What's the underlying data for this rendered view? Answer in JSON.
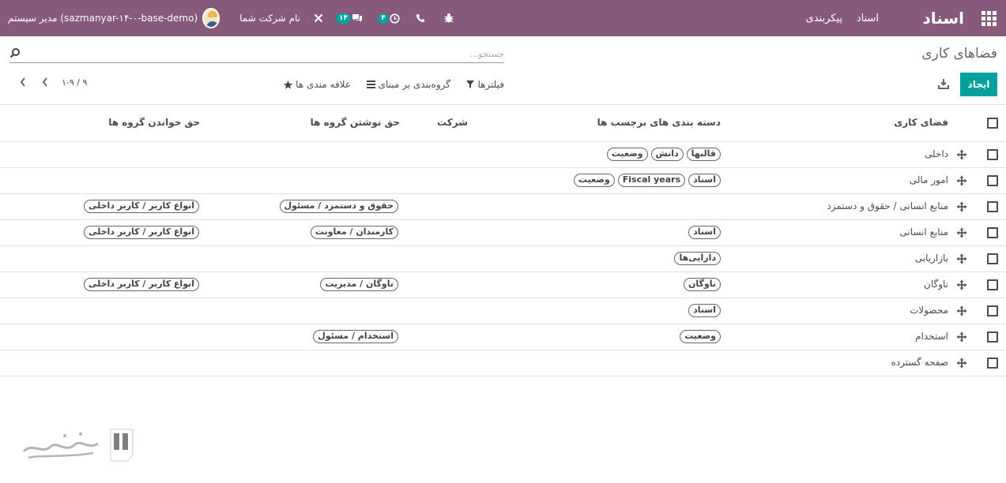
{
  "navbar": {
    "brand": "اسناد",
    "menus": [
      "اسناد",
      "پیکربندی"
    ],
    "activity_count": "۴",
    "message_count": "۱۴",
    "company": "نام شرکت شما",
    "user": "مدیر سیستم (sazmanyar-۱۴-۰-base-demo)",
    "color": "#875a7b"
  },
  "control_panel": {
    "title": "فضاهای کاری",
    "search_placeholder": "جستجو...",
    "create_label": "ایجاد",
    "filters_label": "فیلترها",
    "groupby_label": "گروه‌بندی بر مبنای",
    "favorites_label": "علاقه مندی ها",
    "pager": "۱-۹ / ۹",
    "accent_color": "#00a09d"
  },
  "table": {
    "columns": [
      "فضای کاری",
      "دسته بندی های برچسب ها",
      "شرکت",
      "حق نوشتن گروه ها",
      "حق خواندن گروه ها"
    ],
    "rows": [
      {
        "name": "داخلی",
        "tags": [
          "وضعیت",
          "دانش",
          "قالبها"
        ],
        "company": "",
        "write_groups": [],
        "read_groups": []
      },
      {
        "name": "امور مالی",
        "tags": [
          "وضعیت",
          "Fiscal years",
          "اسناد"
        ],
        "company": "",
        "write_groups": [],
        "read_groups": []
      },
      {
        "name": "منابع انسانی / حقوق و دستمزد",
        "tags": [],
        "company": "",
        "write_groups": [
          "حقوق و دستمزد / مسئول"
        ],
        "read_groups": [
          "انواع کاربر / کاربر داخلی"
        ]
      },
      {
        "name": "منابع انسانی",
        "tags": [
          "اسناد"
        ],
        "company": "",
        "write_groups": [
          "کارمندان / معاونت"
        ],
        "read_groups": [
          "انواع کاربر / کاربر داخلی"
        ]
      },
      {
        "name": "بازاریابی",
        "tags": [
          "دارایی‌ها"
        ],
        "company": "",
        "write_groups": [],
        "read_groups": []
      },
      {
        "name": "ناوگان",
        "tags": [
          "ناوگان"
        ],
        "company": "",
        "write_groups": [
          "ناوگان / مدیریت"
        ],
        "read_groups": [
          "انواع کاربر / کاربر داخلی"
        ]
      },
      {
        "name": "محصولات",
        "tags": [
          "اسناد"
        ],
        "company": "",
        "write_groups": [],
        "read_groups": []
      },
      {
        "name": "استخدام",
        "tags": [
          "وضعیت"
        ],
        "company": "",
        "write_groups": [
          "استخدام / مسئول"
        ],
        "read_groups": []
      },
      {
        "name": "صفحه گسترده",
        "tags": [],
        "company": "",
        "write_groups": [],
        "read_groups": []
      }
    ]
  }
}
